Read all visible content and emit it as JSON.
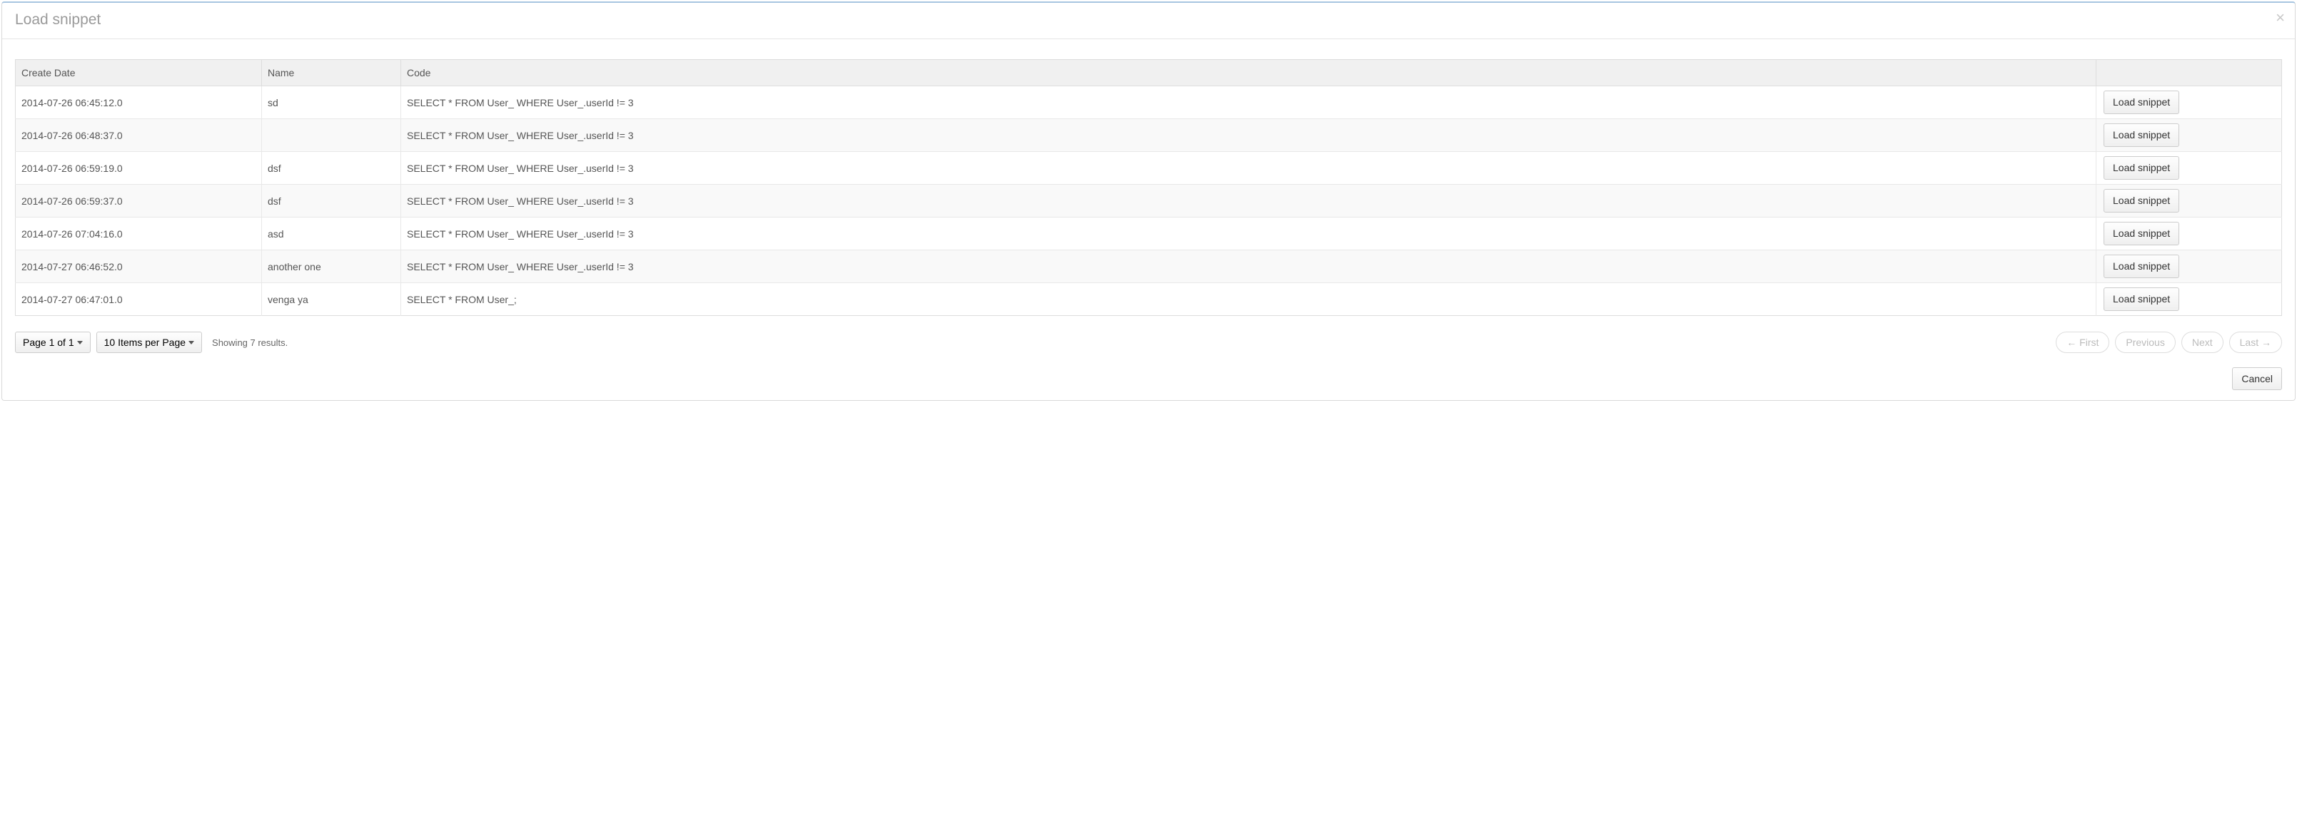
{
  "modal": {
    "title": "Load snippet",
    "close_symbol": "×"
  },
  "table": {
    "headers": {
      "create_date": "Create Date",
      "name": "Name",
      "code": "Code",
      "action": ""
    },
    "action_button_label": "Load snippet",
    "rows": [
      {
        "create_date": "2014-07-26 06:45:12.0",
        "name": "sd",
        "code": "SELECT * FROM User_ WHERE User_.userId != 3"
      },
      {
        "create_date": "2014-07-26 06:48:37.0",
        "name": "",
        "code": "SELECT * FROM User_ WHERE User_.userId != 3"
      },
      {
        "create_date": "2014-07-26 06:59:19.0",
        "name": "dsf",
        "code": "SELECT * FROM User_ WHERE User_.userId != 3"
      },
      {
        "create_date": "2014-07-26 06:59:37.0",
        "name": "dsf",
        "code": "SELECT * FROM User_ WHERE User_.userId != 3"
      },
      {
        "create_date": "2014-07-26 07:04:16.0",
        "name": "asd",
        "code": "SELECT * FROM User_ WHERE User_.userId != 3"
      },
      {
        "create_date": "2014-07-27 06:46:52.0",
        "name": "another one",
        "code": "SELECT * FROM User_ WHERE User_.userId != 3"
      },
      {
        "create_date": "2014-07-27 06:47:01.0",
        "name": "venga ya",
        "code": "SELECT * FROM User_;"
      }
    ]
  },
  "pagination": {
    "page_selector": "Page 1 of 1",
    "items_per_page": "10 Items per Page",
    "results_text": "Showing 7 results.",
    "first": "← First",
    "previous": "Previous",
    "next": "Next",
    "last": "Last →"
  },
  "footer": {
    "cancel": "Cancel"
  }
}
